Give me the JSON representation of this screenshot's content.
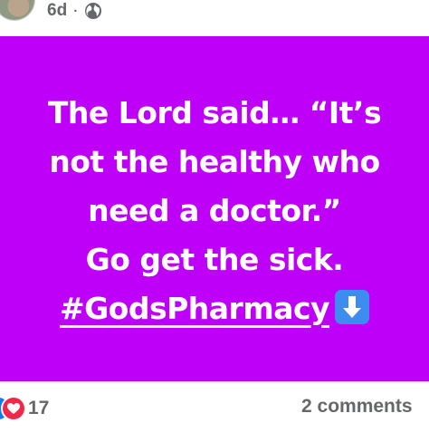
{
  "post_header": {
    "time_ago": "6d",
    "separator": "·",
    "audience_icon": "globe-icon"
  },
  "post_body": {
    "background_color": "#be00f9",
    "text_color": "#ffffff",
    "lines": [
      "The Lord said… “It’s",
      "not the healthy who",
      "need a doctor.”",
      "Go get the sick."
    ],
    "hashtag": "#GodsPharmacy",
    "emoji": "down-arrow-emoji"
  },
  "engagement": {
    "reaction_icons": [
      "like-icon",
      "heart-icon"
    ],
    "reaction_count": "17",
    "comments_label": "2 comments"
  }
}
